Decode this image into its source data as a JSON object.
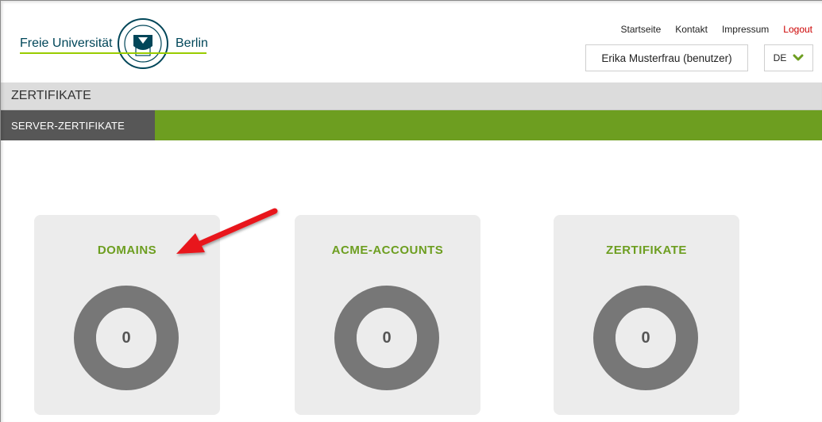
{
  "header": {
    "logo_left": "Freie Universität",
    "logo_right": "Berlin",
    "links": [
      {
        "label": "Startseite"
      },
      {
        "label": "Kontakt"
      },
      {
        "label": "Impressum"
      },
      {
        "label": "Logout"
      }
    ],
    "user": "Erika Musterfrau (benutzer)",
    "language": "DE",
    "language_icon": "chevron-down-icon"
  },
  "title_bar": {
    "title": "ZERTIFIKATE"
  },
  "nav": {
    "active_label": "SERVER-ZERTIFIKATE"
  },
  "cards": [
    {
      "title": "DOMAINS",
      "count": "0"
    },
    {
      "title": "ACME-ACCOUNTS",
      "count": "0"
    },
    {
      "title": "ZERTIFIKATE",
      "count": "0"
    }
  ],
  "colors": {
    "accent_green": "#6d9e20",
    "nav_active": "#575757",
    "donut": "#777777",
    "logout_red": "#cc0000",
    "annotation_arrow": "#e8161b"
  }
}
